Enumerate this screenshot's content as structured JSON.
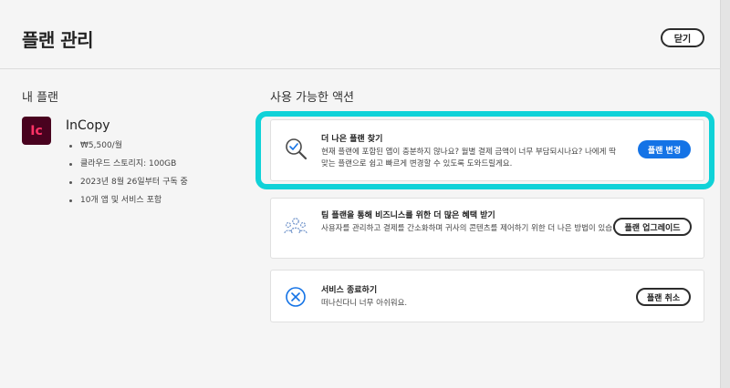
{
  "header": {
    "title": "플랜 관리",
    "close_label": "닫기"
  },
  "my_plan": {
    "section_title": "내 플랜",
    "app_icon_text": "Ic",
    "app_name": "InCopy",
    "details": [
      "₩5,500/월",
      "클라우드 스토리지: 100GB",
      "2023년 8월 26일부터 구독 중",
      "10개 앱 및 서비스 포함"
    ]
  },
  "actions": {
    "section_title": "사용 가능한 액션",
    "cards": [
      {
        "heading": "더 나은 플랜 찾기",
        "description": "현재 플랜에 포함된 앱이 충분하지 않나요? 월별 결제 금액이 너무 부담되시나요? 나에게 딱 맞는 플랜으로 쉽고 빠르게 변경할 수 있도록 도와드릴게요.",
        "button_label": "플랜 변경",
        "icon": "magnifier-check-icon"
      },
      {
        "heading": "팀 플랜을 통해 비즈니스를 위한 더 많은 혜택 받기",
        "description": "사용자를 관리하고 결제를 간소화하며 귀사의 콘텐츠를 제어하기 위한 더 나은 방법이 있습니다.",
        "button_label": "플랜 업그레이드",
        "icon": "team-icon"
      },
      {
        "heading": "서비스 종료하기",
        "description": "떠나신다니 너무 아쉬워요.",
        "button_label": "플랜 취소",
        "icon": "cancel-circle-icon"
      }
    ]
  },
  "colors": {
    "accent": "#1473e6",
    "highlight": "#10d2d8",
    "app_icon_bg": "#49021f",
    "app_icon_fg": "#ff3366"
  }
}
